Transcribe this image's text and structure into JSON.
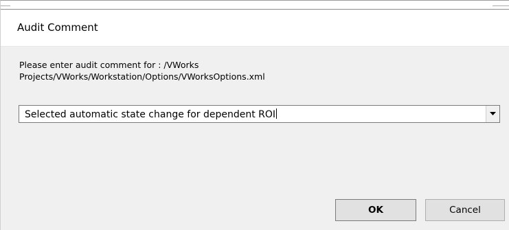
{
  "dialog": {
    "title": "Audit Comment",
    "prompt_line1": "Please enter audit comment for : /VWorks",
    "prompt_line2": "Projects/VWorks/Workstation/Options/VWorksOptions.xml",
    "comment_value": "Selected automatic state change for dependent ROI",
    "ok_label": "OK",
    "cancel_label": "Cancel"
  },
  "icons": {
    "dropdown": "chevron-down-icon"
  },
  "colors": {
    "background": "#f0f0f0",
    "title_background": "#ffffff",
    "button_face": "#e1e1e1"
  }
}
